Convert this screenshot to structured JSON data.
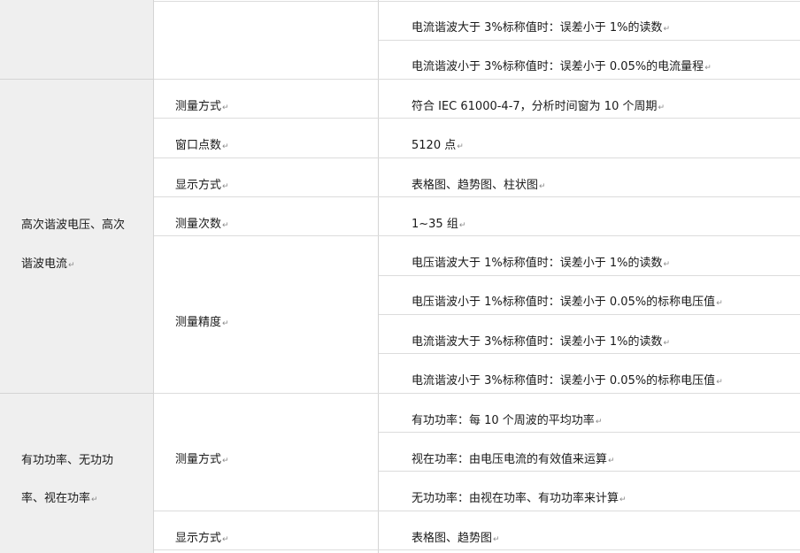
{
  "paragraph_mark": "↵",
  "rows": {
    "top": {
      "values": [
        "电流谐波大于 3%标称值时：误差小于 1%的读数",
        "电流谐波小于 3%标称值时：误差小于 0.05%的电流量程"
      ]
    },
    "high_harmonic": {
      "category_line1": "高次谐波电压、高次",
      "category_line2": "谐波电流",
      "items": [
        {
          "label": "测量方式",
          "value": "符合 IEC 61000-4-7，分析时间窗为 10 个周期"
        },
        {
          "label": "窗口点数",
          "value": "5120 点"
        },
        {
          "label": "显示方式",
          "value": "表格图、趋势图、柱状图"
        },
        {
          "label": "测量次数",
          "value": "1~35 组"
        }
      ],
      "accuracy_label": "测量精度",
      "accuracy_values": [
        "电压谐波大于 1%标称值时：误差小于 1%的读数",
        "电压谐波小于 1%标称值时：误差小于 0.05%的标称电压值",
        "电流谐波大于 3%标称值时：误差小于 1%的读数",
        "电流谐波小于 3%标称值时：误差小于 0.05%的标称电压值"
      ]
    },
    "power": {
      "category_line1": "有功功率、无功功",
      "category_line2": "率、视在功率",
      "method_label": "测量方式",
      "method_values": [
        "有功功率：每 10 个周波的平均功率",
        "视在功率：由电压电流的有效值来运算",
        "无功功率：由视在功率、有功功率来计算"
      ],
      "display_label": "显示方式",
      "display_value": "表格图、趋势图"
    }
  }
}
